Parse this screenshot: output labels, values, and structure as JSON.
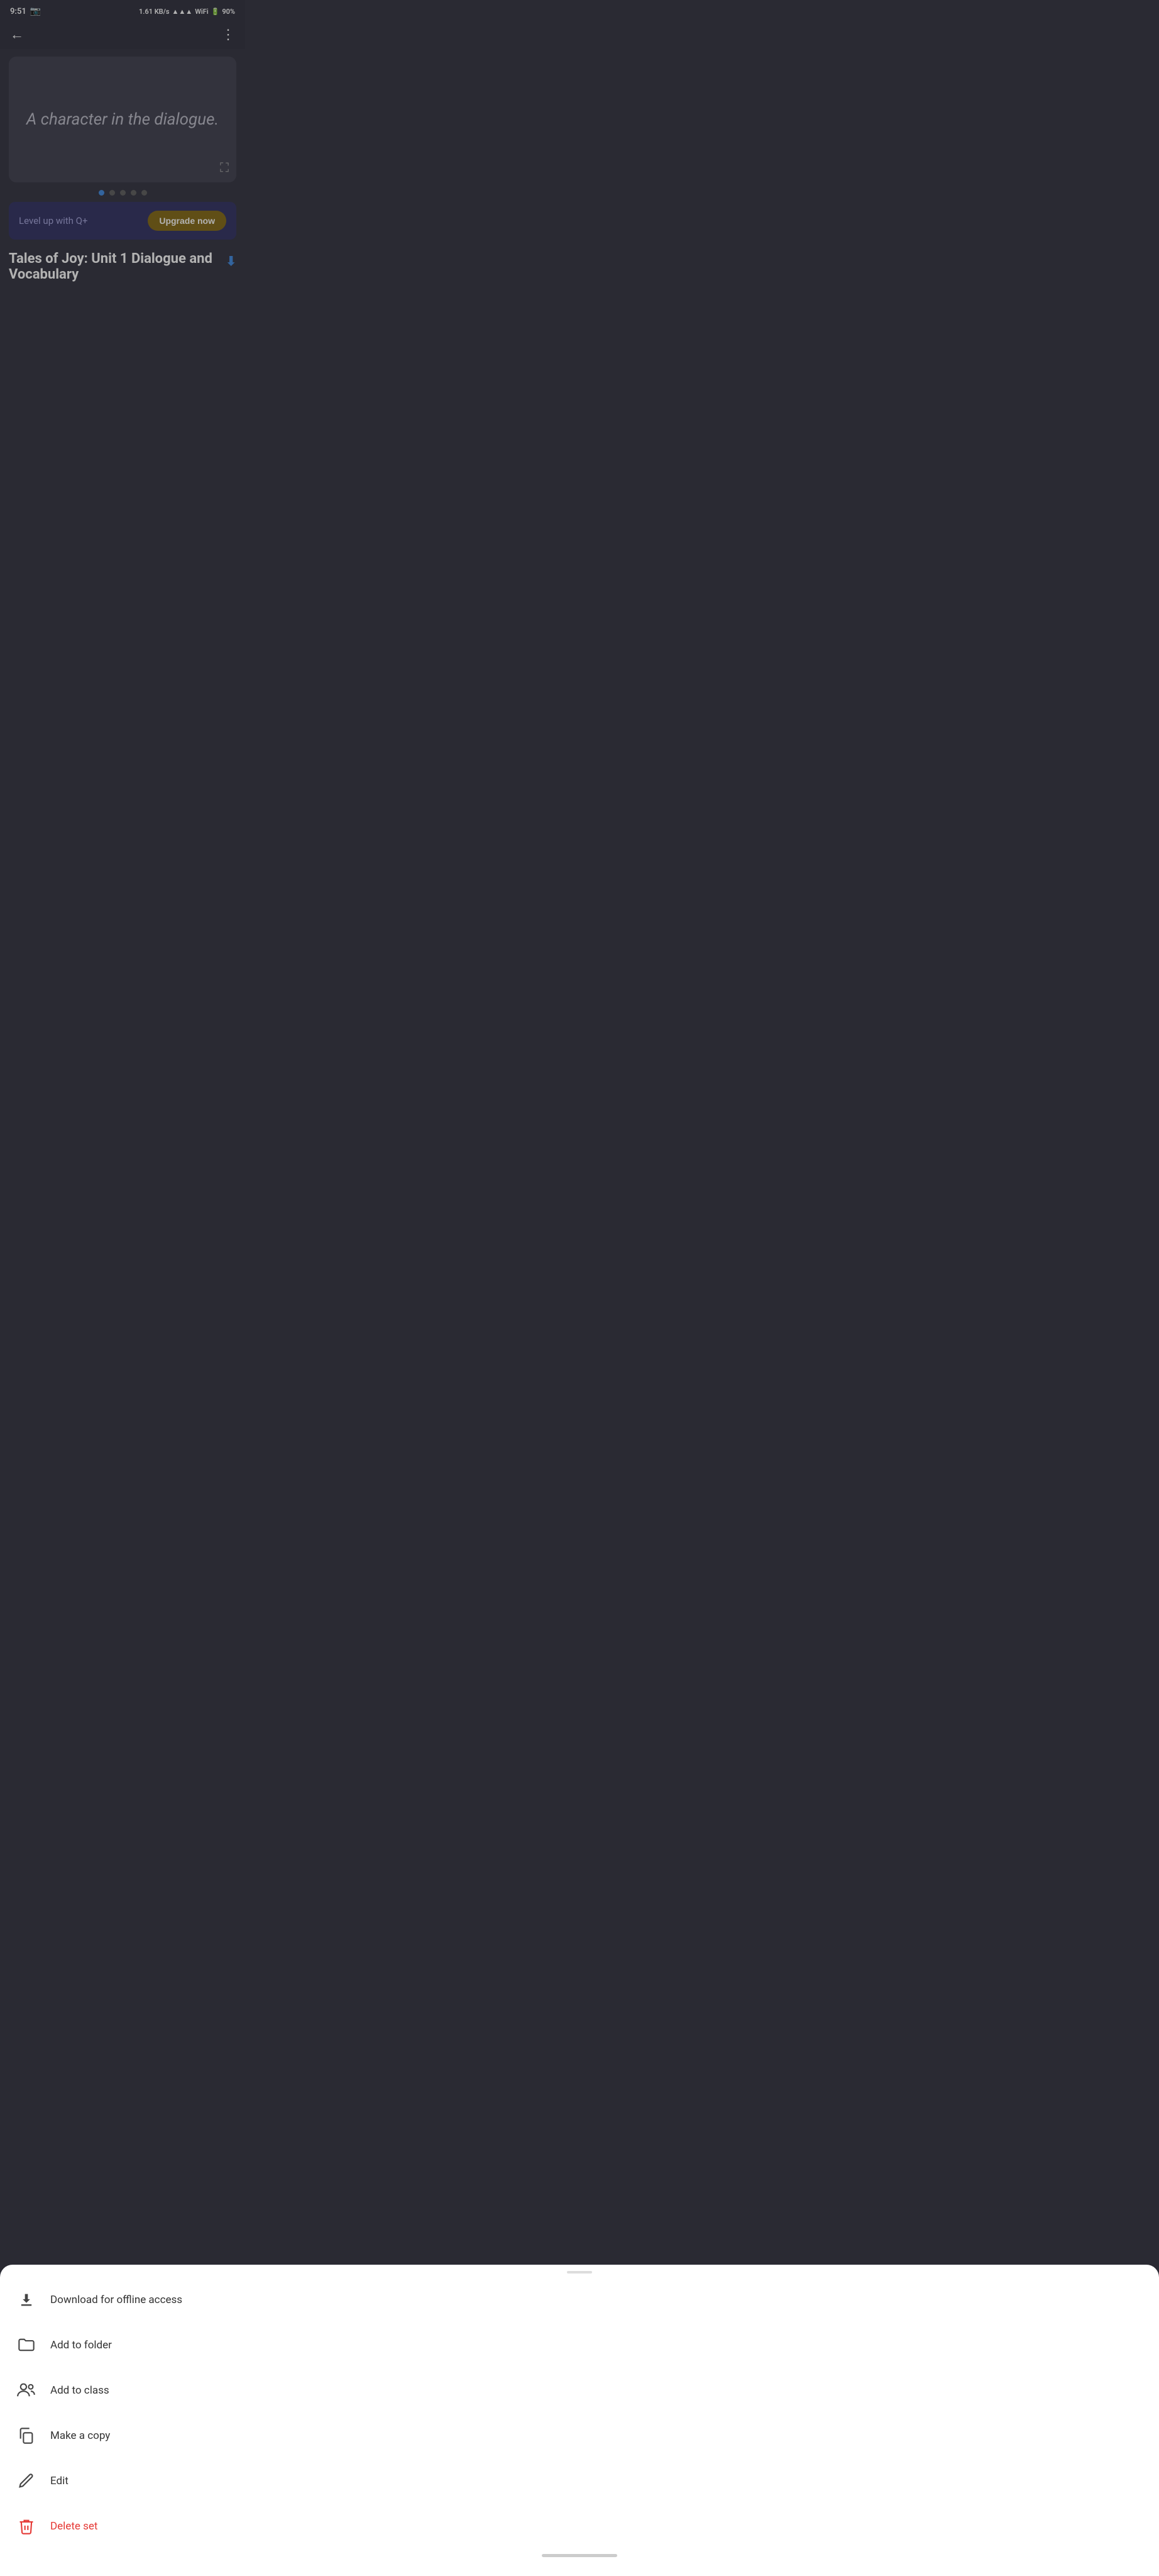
{
  "status_bar": {
    "time": "9:51",
    "speed": "1.61 KB/s",
    "battery": "90%",
    "wifi": true
  },
  "nav": {
    "back_label": "←",
    "more_label": "⋮"
  },
  "card": {
    "text": "A character in the dialogue."
  },
  "dots": {
    "count": 5,
    "active_index": 0
  },
  "upgrade_banner": {
    "text": "Level up with Q+",
    "button_label": "Upgrade now"
  },
  "set_title": {
    "text": "Tales of Joy: Unit 1 Dialogue and Vocabulary"
  },
  "bottom_sheet": {
    "items": [
      {
        "id": "download",
        "icon": "download",
        "label": "Download for offline access",
        "color": "normal"
      },
      {
        "id": "add-folder",
        "icon": "folder",
        "label": "Add to folder",
        "color": "normal"
      },
      {
        "id": "add-class",
        "icon": "people",
        "label": "Add to class",
        "color": "normal"
      },
      {
        "id": "make-copy",
        "icon": "copy",
        "label": "Make a copy",
        "color": "normal"
      },
      {
        "id": "edit",
        "icon": "edit",
        "label": "Edit",
        "color": "normal"
      },
      {
        "id": "delete",
        "icon": "trash",
        "label": "Delete set",
        "color": "red"
      }
    ]
  },
  "home_indicator": true
}
